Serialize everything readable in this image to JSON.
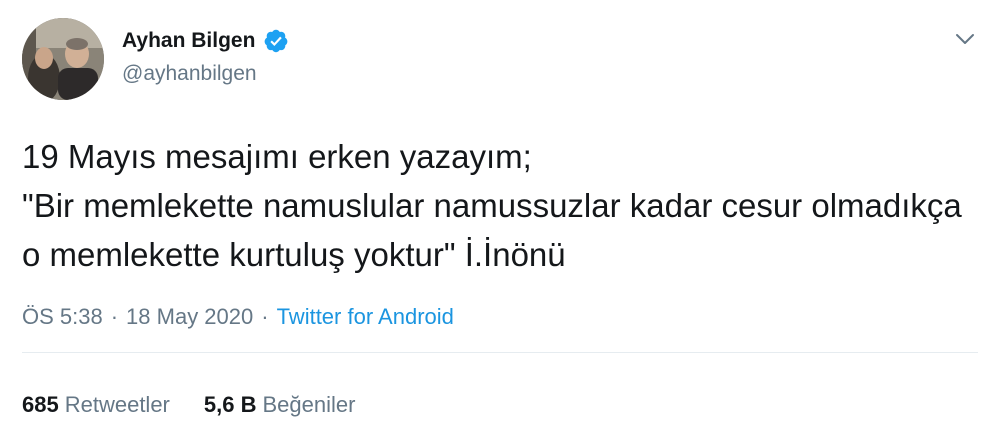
{
  "user": {
    "display_name": "Ayhan Bilgen",
    "handle": "@ayhanbilgen",
    "verified": true
  },
  "tweet": {
    "text": "19 Mayıs mesajımı erken yazayım;\n\"Bir memlekette namuslular namussuzlar kadar cesur olmadıkça o memlekette kurtuluş yoktur\" İ.İnönü"
  },
  "meta": {
    "time": "ÖS 5:38",
    "separator": "·",
    "date": "18 May 2020",
    "source": "Twitter for Android"
  },
  "stats": {
    "retweets_count": "685",
    "retweets_label": "Retweetler",
    "likes_count": "5,6 B",
    "likes_label": "Beğeniler"
  },
  "colors": {
    "text": "#14171a",
    "secondary": "#657786",
    "accent": "#1b95e0",
    "verified": "#1da1f2",
    "divider": "#e6ecf0"
  },
  "icons": {
    "verified": "verified-badge-icon",
    "menu": "chevron-down-icon"
  }
}
